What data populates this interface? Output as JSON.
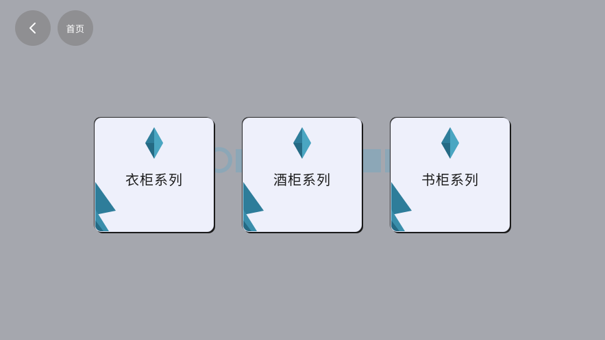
{
  "nav": {
    "back_icon": "chevron-left-icon",
    "home_label": "首页"
  },
  "cards": [
    {
      "label": "衣柜系列",
      "icon": "diamond-gem-icon"
    },
    {
      "label": "酒柜系列",
      "icon": "diamond-gem-icon"
    },
    {
      "label": "书柜系列",
      "icon": "diamond-gem-icon"
    }
  ],
  "colors": {
    "background": "#a5a7ae",
    "nav_button": "#8f8f92",
    "card_bg": "#eef0fb",
    "accent_teal_dark": "#2e7d9a",
    "accent_teal_light": "#4aa6c2"
  }
}
